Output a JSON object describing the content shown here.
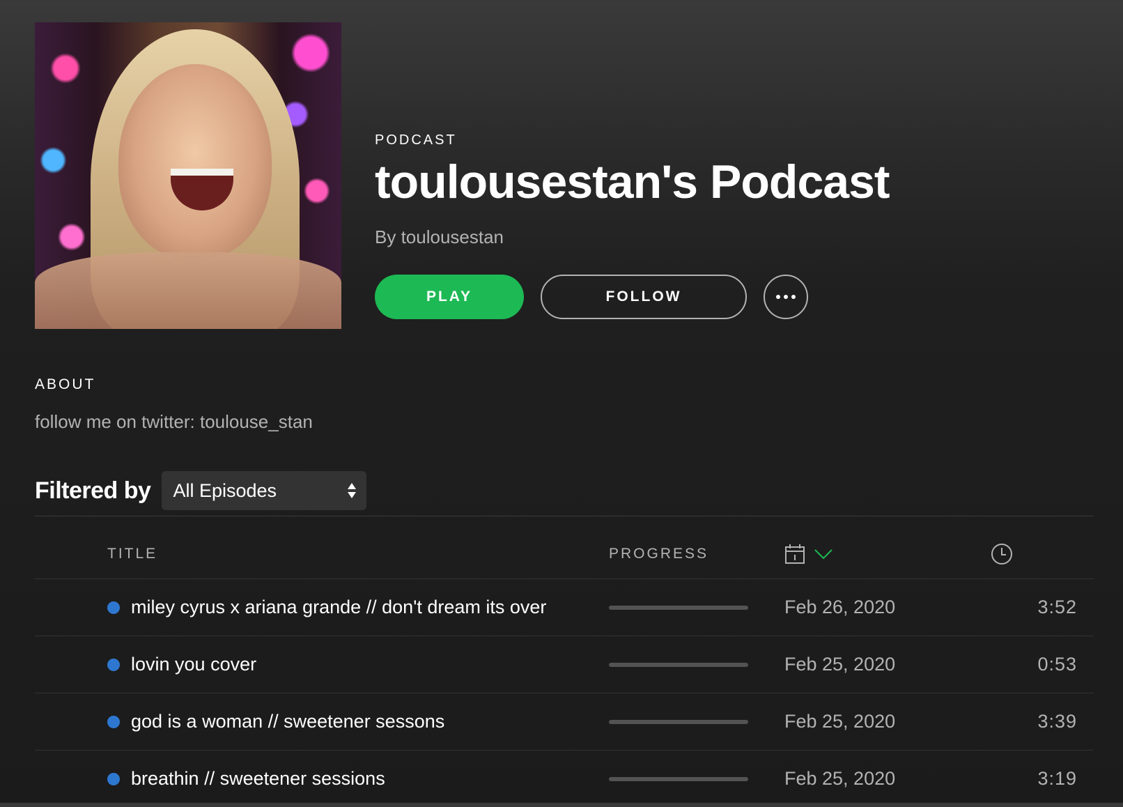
{
  "header": {
    "type_label": "PODCAST",
    "title": "toulousestan's Podcast",
    "byline": "By toulousestan",
    "play_label": "PLAY",
    "follow_label": "FOLLOW",
    "more_icon": "more-horizontal-icon",
    "cover_image": "podcast-cover-art"
  },
  "about": {
    "heading": "ABOUT",
    "text": "follow me on twitter: toulouse_stan"
  },
  "filter": {
    "label": "Filtered by",
    "selected": "All Episodes",
    "icon": "select-arrows-icon"
  },
  "table": {
    "columns": {
      "title": "TITLE",
      "progress": "PROGRESS",
      "date_icon": "calendar-icon",
      "sort_icon": "chevron-down-icon",
      "duration_icon": "clock-icon"
    },
    "episodes": [
      {
        "title": "miley cyrus x ariana grande // don't dream its over",
        "progress": 0,
        "date": "Feb 26, 2020",
        "duration": "3:52"
      },
      {
        "title": "lovin you cover",
        "progress": 0,
        "date": "Feb 25, 2020",
        "duration": "0:53"
      },
      {
        "title": "god is a woman // sweetener sessons",
        "progress": 0,
        "date": "Feb 25, 2020",
        "duration": "3:39"
      },
      {
        "title": "breathin // sweetener sessions",
        "progress": 0,
        "date": "Feb 25, 2020",
        "duration": "3:19"
      }
    ]
  },
  "colors": {
    "accent": "#1db954",
    "unplayed_dot": "#2e77d0",
    "sort_indicator": "#1db954"
  }
}
